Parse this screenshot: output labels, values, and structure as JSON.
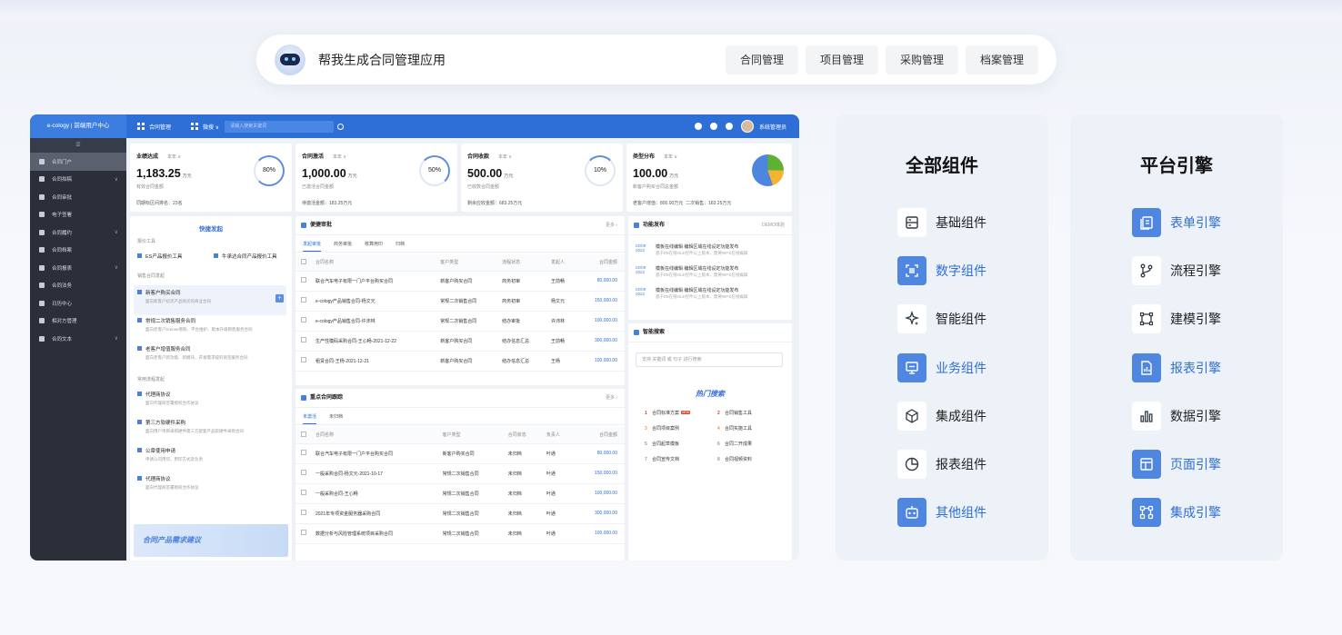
{
  "prompt": {
    "text": "帮我生成合同管理应用",
    "chips": [
      "合同管理",
      "项目管理",
      "采购管理",
      "档案管理"
    ]
  },
  "app": {
    "brand": "e-cology | 前端用户中心",
    "header_title": "合同管理",
    "header_module": "微搜 ∨",
    "search_placeholder": "请输入搜索关键词",
    "user_name": "系统管理员",
    "sidebar_items": [
      {
        "label": "合同门户",
        "active": true,
        "chevron": false
      },
      {
        "label": "合同拟稿",
        "active": false,
        "chevron": true
      },
      {
        "label": "合同审批",
        "active": false,
        "chevron": false
      },
      {
        "label": "电子签署",
        "active": false,
        "chevron": false
      },
      {
        "label": "合同履约",
        "active": false,
        "chevron": true
      },
      {
        "label": "合同档案",
        "active": false,
        "chevron": false
      },
      {
        "label": "合同报表",
        "active": false,
        "chevron": true
      },
      {
        "label": "合同法务",
        "active": false,
        "chevron": false
      },
      {
        "label": "日历中心",
        "active": false,
        "chevron": false
      },
      {
        "label": "相对方管理",
        "active": false,
        "chevron": false
      },
      {
        "label": "合同文本",
        "active": false,
        "chevron": true
      }
    ],
    "year_label": "本年 ∨",
    "stats": [
      {
        "title": "业绩达成",
        "value": "1,183.25",
        "unit": "万元",
        "sub": "有效合同金额",
        "foot": "同期标区间排名：23名",
        "ring": "80%"
      },
      {
        "title": "合同激活",
        "value": "1,000.00",
        "unit": "万元",
        "sub": "已激活合同金额",
        "foot": "待激活金额：183.25万元",
        "ring": "50%"
      },
      {
        "title": "合同收款",
        "value": "500.00",
        "unit": "万元",
        "sub": "已收款合同金额",
        "foot": "剩余应收金额：683.25万元",
        "ring": "10%"
      },
      {
        "title": "类型分布",
        "value": "100.00",
        "unit": "万元",
        "sub": "新客户购买合同总金额",
        "foot1": "老客户增值：800.00万元",
        "foot2": "二次销售：183.25万元"
      }
    ],
    "quick": {
      "title": "快捷发起",
      "group1": "报价工具",
      "tools": [
        "ES产品报价工具",
        "牛承达合同产品报价工具"
      ],
      "group2": "销售合同发起",
      "items": [
        {
          "title": "新客户购买合同",
          "desc": "面向新客户初次产品购买的商业合同"
        },
        {
          "title": "常规二次销售服务合同",
          "desc": "面向老客户license增购、平台维护、版本升级销售服务合同"
        },
        {
          "title": "老客户增值服务合同",
          "desc": "面向老客户新功能、新模块、开发需求提的商签服务合同"
        }
      ],
      "group3": "常用流程发起",
      "flows": [
        {
          "title": "代理商协议",
          "desc": "面向代理商签署授权合作协议"
        },
        {
          "title": "第三方软硬件采购",
          "desc": "面向用户项目采购硬件需三方配套产品软硬件采购合同"
        },
        {
          "title": "公章使用申请",
          "desc": "申请公司用印，用印方式及负责"
        },
        {
          "title": "代理商协议",
          "desc": "面向代理商签署授权合作协议"
        }
      ],
      "banner": "合同产品需求建议"
    },
    "approval": {
      "title": "便捷审批",
      "more": "更多 ›",
      "tabs": [
        "发起审批",
        "商务审批",
        "核算用印",
        "归档"
      ],
      "cols": [
        "合同名称",
        "客户类型",
        "流程状态",
        "发起人",
        "合同金额"
      ],
      "rows": [
        [
          "联合汽车电子有限一门户平台购买合同",
          "新客户购买合同",
          "商务初审",
          "王前畅",
          "80,000.00"
        ],
        [
          "e-cology产品销售合同-杨文元",
          "常规二次销售合同",
          "商务初审",
          "杨文元",
          "150,000.00"
        ],
        [
          "e-cology产品销售合同-许沛林",
          "常规二次销售合同",
          "结办审批",
          "许沛林",
          "100,000.00"
        ],
        [
          "生产性模码采购合同-王心畅-2021-12-22",
          "新客户购买合同",
          "结办信息汇总",
          "王前畅",
          "300,000.00"
        ],
        [
          "租赁合同-王杨-2021-12-21",
          "新客户购买合同",
          "结办信息汇总",
          "王杨",
          "100,000.00"
        ]
      ]
    },
    "tracking": {
      "title": "重点合同跟踪",
      "more": "更多 ›",
      "tabs": [
        "未激活",
        "未归档"
      ],
      "cols": [
        "合同名称",
        "客户类型",
        "合同状态",
        "负责人",
        "合同金额"
      ],
      "rows": [
        [
          "联合汽车电子有限一门户平台购买合同",
          "新客户购买合同",
          "未归档",
          "叶通",
          "80,000.00"
        ],
        [
          "一般采购合同-杨文元-2021-10-17",
          "常规二次销售合同",
          "未归档",
          "叶通",
          "150,000.00"
        ],
        [
          "一般采购合同-王心畅",
          "常规二次销售合同",
          "未归档",
          "叶通",
          "100,000.00"
        ],
        [
          "2021年专项资金服务器采购合同",
          "常规二次销售合同",
          "未归档",
          "叶通",
          "300,000.00"
        ],
        [
          "数据分析与风险管理系统项目采购合同",
          "常规二次销售合同",
          "未归档",
          "叶通",
          "100,000.00"
        ]
      ]
    },
    "release": {
      "title": "功能发布",
      "more": "DEMO体验",
      "items": [
        {
          "date": "02/09 2022",
          "title": "模板在线编辑 编辑区域在线设定功能发布",
          "desc": "基于E9在线OLE控件以上版本，需要WPS在线编辑"
        },
        {
          "date": "02/09 2022",
          "title": "模板在线编辑 编辑区域在线设定功能发布",
          "desc": "基于E9在线OLE控件以上版本，需要WPS在线编辑"
        },
        {
          "date": "02/09 2022",
          "title": "模板在线编辑 编辑区域在线设定功能发布",
          "desc": "基于E9在线OLE控件以上版本，需要WPS在线编辑"
        }
      ]
    },
    "smart": {
      "title": "智能搜索",
      "search_hint": "支持 关键词 或 句子 进行搜索",
      "hot_title": "热门搜索",
      "hot": [
        {
          "rank": "1",
          "label": "合同标准方案",
          "new": true
        },
        {
          "rank": "2",
          "label": "合同销售工具",
          "new": false
        },
        {
          "rank": "3",
          "label": "合同项目案例",
          "new": false
        },
        {
          "rank": "4",
          "label": "合同实施工具",
          "new": false
        },
        {
          "rank": "5",
          "label": "合同起草模板",
          "new": false
        },
        {
          "rank": "6",
          "label": "合同二开成果",
          "new": false
        },
        {
          "rank": "7",
          "label": "合同宣传文档",
          "new": false
        },
        {
          "rank": "8",
          "label": "合同视频资料",
          "new": false
        }
      ],
      "new_tag": "NEW"
    }
  },
  "components": {
    "title": "全部组件",
    "items": [
      {
        "label": "基础组件",
        "icon": "server-icon",
        "active": false
      },
      {
        "label": "数字组件",
        "icon": "scan-icon",
        "active": true
      },
      {
        "label": "智能组件",
        "icon": "sparkle-icon",
        "active": false
      },
      {
        "label": "业务组件",
        "icon": "monitor-icon",
        "active": true
      },
      {
        "label": "集成组件",
        "icon": "cube-icon",
        "active": false
      },
      {
        "label": "报表组件",
        "icon": "pie-chart-icon",
        "active": false
      },
      {
        "label": "其他组件",
        "icon": "robot-icon",
        "active": true
      }
    ]
  },
  "engines": {
    "title": "平台引擎",
    "items": [
      {
        "label": "表单引擎",
        "icon": "form-icon",
        "active": true
      },
      {
        "label": "流程引擎",
        "icon": "flow-icon",
        "active": false
      },
      {
        "label": "建模引擎",
        "icon": "model-icon",
        "active": false
      },
      {
        "label": "报表引擎",
        "icon": "report-icon",
        "active": true
      },
      {
        "label": "数据引擎",
        "icon": "bar-chart-icon",
        "active": false
      },
      {
        "label": "页面引擎",
        "icon": "layout-icon",
        "active": true
      },
      {
        "label": "集成引擎",
        "icon": "integration-icon",
        "active": true
      }
    ]
  },
  "colors": {
    "accent": "#2e6fd6",
    "icon_blue": "#4f86e0",
    "sidebar": "#2a2f3a"
  }
}
